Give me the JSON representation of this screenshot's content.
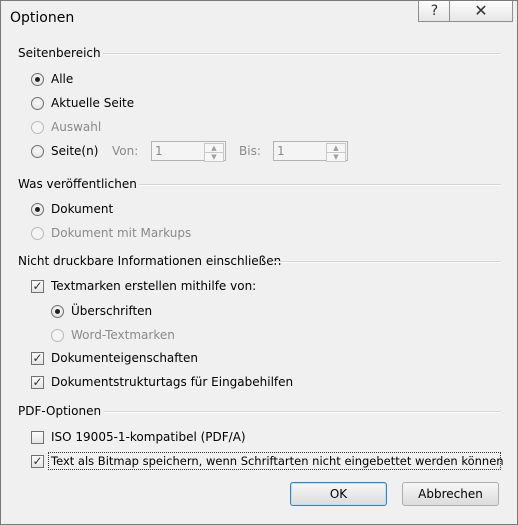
{
  "window": {
    "title": "Optionen",
    "help_glyph": "?",
    "close_glyph": "✕"
  },
  "page_range": {
    "heading": "Seitenbereich",
    "all_label": "Alle",
    "current_label": "Aktuelle Seite",
    "selection_label": "Auswahl",
    "pages_label": "Seite(n)",
    "from_label": "Von:",
    "from_value": "1",
    "to_label": "Bis:",
    "to_value": "1",
    "selected": "Alle"
  },
  "publish_what": {
    "heading": "Was veröffentlichen",
    "document_label": "Dokument",
    "markup_label": "Dokument mit Markups",
    "selected": "Dokument"
  },
  "nonprint": {
    "heading": "Nicht druckbare Informationen einschließen",
    "bookmarks_label": "Textmarken erstellen mithilfe von:",
    "bookmarks_checked": true,
    "headings_label": "Überschriften",
    "word_bookmarks_label": "Word-Textmarken",
    "bookmark_source": "Überschriften",
    "properties_label": "Dokumenteigenschaften",
    "properties_checked": true,
    "structure_label": "Dokumentstrukturtags für Eingabehilfen",
    "structure_checked": true
  },
  "pdf_options": {
    "heading": "PDF-Optionen",
    "iso_label": "ISO 19005-1-kompatibel (PDF/A)",
    "iso_checked": false,
    "bitmap_label": "Text als Bitmap speichern, wenn Schriftarten nicht eingebettet werden können",
    "bitmap_checked": true
  },
  "buttons": {
    "ok": "OK",
    "cancel": "Abbrechen"
  }
}
